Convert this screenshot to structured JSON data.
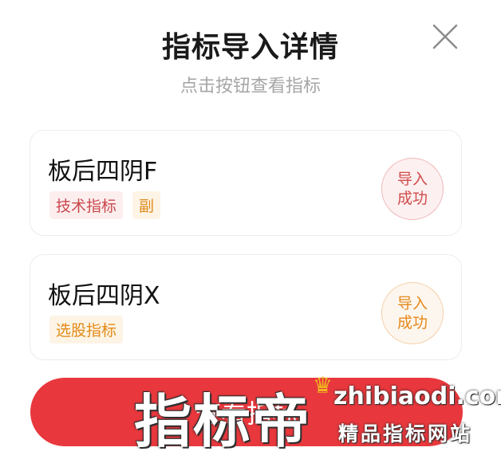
{
  "dialog": {
    "title": "指标导入详情",
    "subtitle": "点击按钮查看指标",
    "close_icon": "close-icon"
  },
  "items": [
    {
      "name": "板后四阴F",
      "tags": [
        "技术指标",
        "副"
      ],
      "tag_colors": [
        "#c9484d",
        "#e38a17"
      ],
      "status_line1": "导入",
      "status_line2": "成功",
      "status_color": "#d14b4b"
    },
    {
      "name": "板后四阴X",
      "tags": [
        "选股指标"
      ],
      "tag_colors": [
        "#e38a17"
      ],
      "status_line1": "导入",
      "status_line2": "成功",
      "status_color": "#e6891c"
    }
  ],
  "action": {
    "button_label": "查看指标",
    "button_color": "#e8383d"
  },
  "watermark": {
    "logo": "指标帝",
    "domain": "zhibiaodi.com",
    "slogan": "精品指标网站"
  }
}
